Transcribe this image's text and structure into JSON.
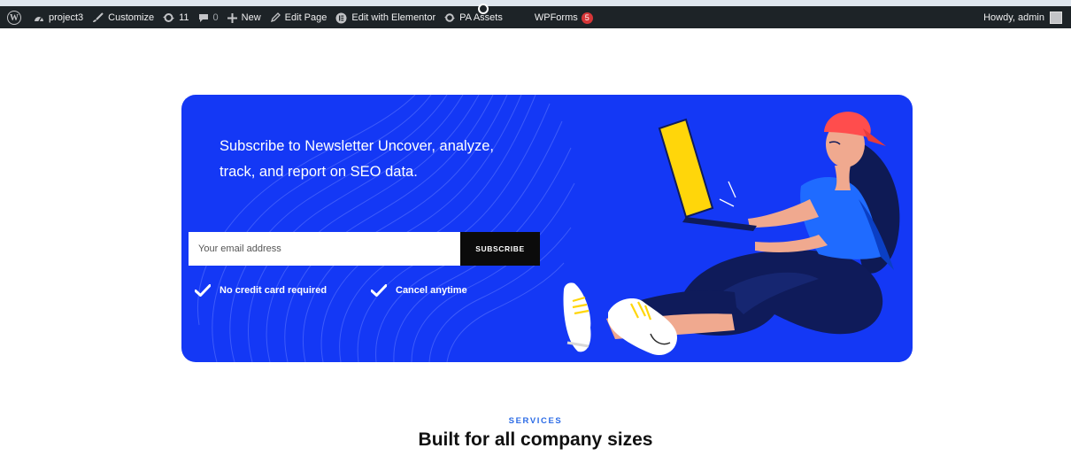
{
  "admin_bar": {
    "site_name": "project3",
    "customize": "Customize",
    "updates_count": "11",
    "comments_count": "0",
    "new": "New",
    "edit_page": "Edit Page",
    "edit_elementor": "Edit with Elementor",
    "pa_assets": "PA Assets",
    "wpforms": "WPForms",
    "wpforms_badge": "5",
    "howdy": "Howdy, admin"
  },
  "newsletter": {
    "headline": "Subscribe to Newsletter Uncover, analyze, track, and report on SEO data.",
    "email_placeholder": "Your email address",
    "subscribe_label": "SUBSCRIBE",
    "perk_1": "No credit card required",
    "perk_2": "Cancel anytime",
    "background_color": "#1438f5"
  },
  "services": {
    "eyebrow": "SERVICES",
    "title": "Built for all company sizes"
  }
}
